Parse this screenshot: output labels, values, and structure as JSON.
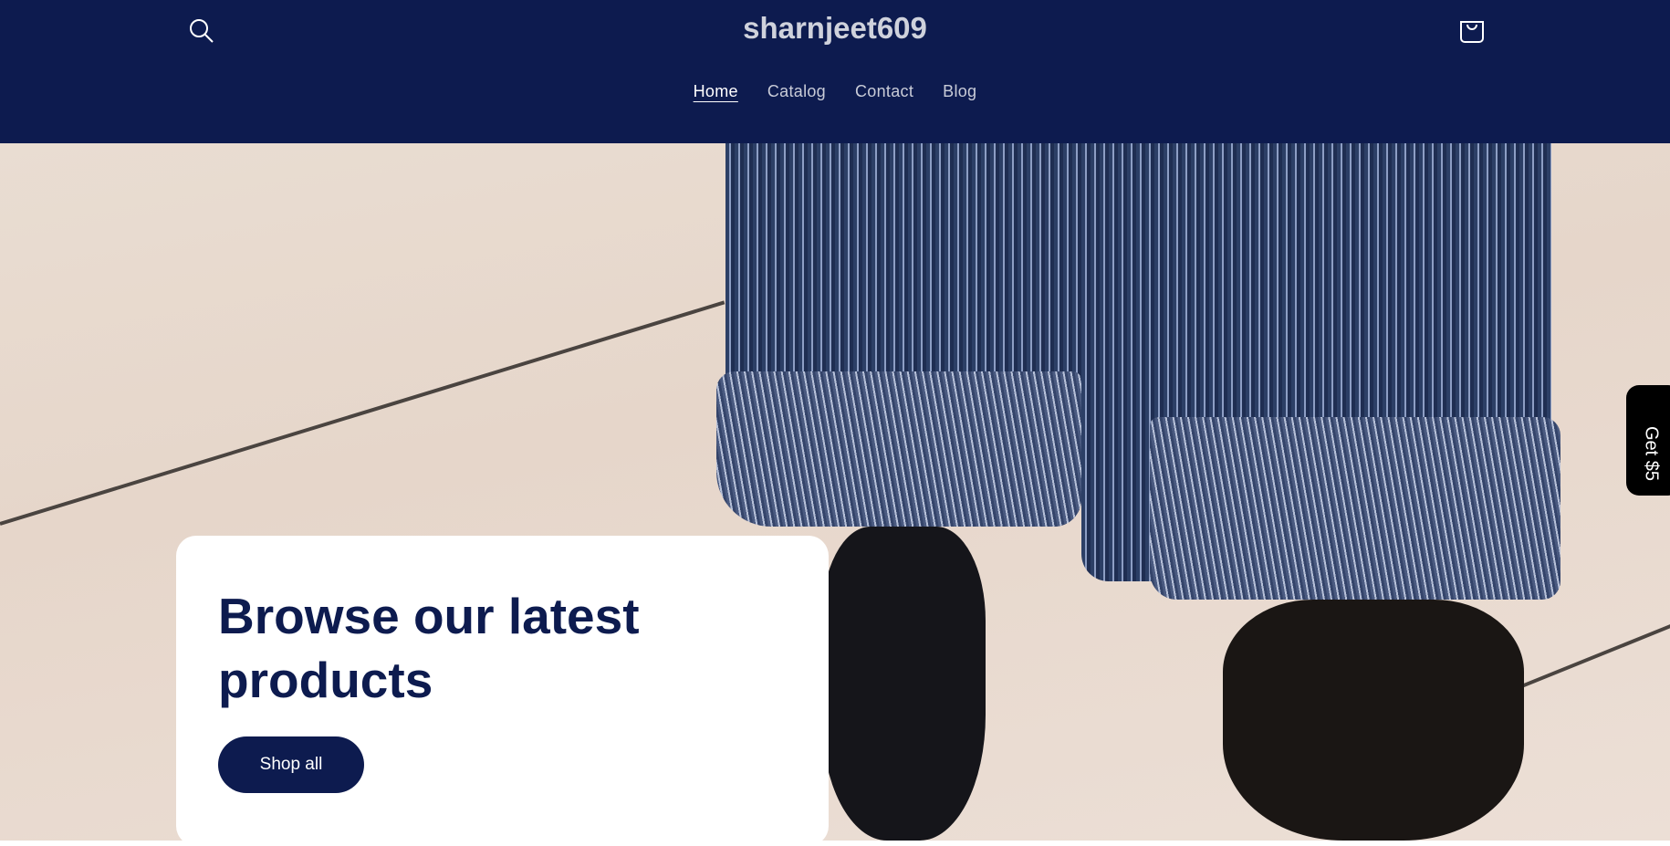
{
  "header": {
    "store_name": "sharnjeet609",
    "search_icon": "search-icon",
    "cart_icon": "cart-icon",
    "nav": [
      {
        "label": "Home",
        "active": true
      },
      {
        "label": "Catalog"
      },
      {
        "label": "Contact"
      },
      {
        "label": "Blog"
      }
    ],
    "background_color": "#0d1b4f"
  },
  "hero": {
    "heading": "Browse our latest products",
    "button_label": "Shop all"
  },
  "promo_tab": {
    "label": "Get $5"
  }
}
